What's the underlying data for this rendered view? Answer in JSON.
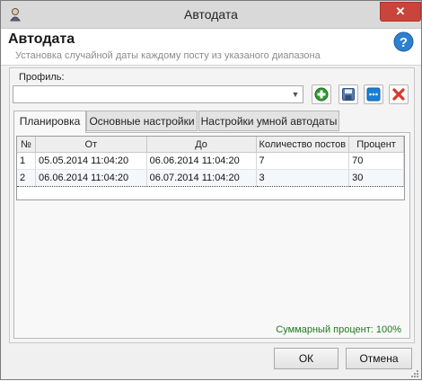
{
  "window": {
    "title": "Автодата",
    "close_glyph": "✕"
  },
  "header": {
    "title": "Автодата",
    "subtitle": "Установка случайной даты каждому посту из указаного диапазона"
  },
  "profile": {
    "label": "Профиль:",
    "value": ""
  },
  "toolbar": {
    "icons": [
      "add-icon",
      "save-icon",
      "more-icon",
      "delete-icon"
    ]
  },
  "tabs": [
    {
      "label": "Планировка",
      "active": true
    },
    {
      "label": "Основные настройки",
      "active": false
    },
    {
      "label": "Настройки умной автодаты",
      "active": false
    }
  ],
  "table": {
    "columns": [
      "№",
      "От",
      "До",
      "Количество постов",
      "Процент"
    ],
    "rows": [
      [
        "1",
        "05.05.2014 11:04:20",
        "06.06.2014 11:04:20",
        "7",
        "70"
      ],
      [
        "2",
        "06.06.2014 11:04:20",
        "06.07.2014 11:04:20",
        "3",
        "30"
      ]
    ],
    "selected_row": 2
  },
  "summary": {
    "text": "Суммарный процент: 100%"
  },
  "buttons": {
    "ok": "ОК",
    "cancel": "Отмена"
  },
  "colors": {
    "close": "#c9443a",
    "add": "#2f9a2f",
    "delete": "#d63a2a",
    "save": "#3a6fb3",
    "more": "#1a7fd4",
    "summary": "#1e7a1e"
  }
}
